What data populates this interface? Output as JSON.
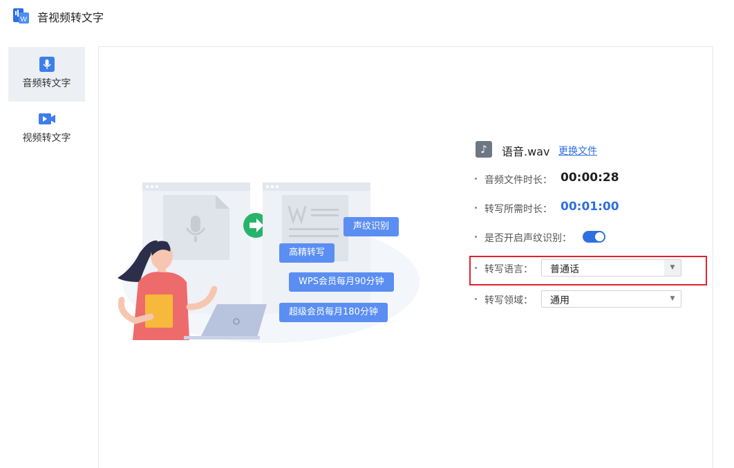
{
  "app": {
    "title": "音视频转文字",
    "logo_icon": "wps-audio-video-logo"
  },
  "sidebar": {
    "items": [
      {
        "label": "音频转文字",
        "icon": "microphone-icon",
        "active": true
      },
      {
        "label": "视频转文字",
        "icon": "video-camera-icon",
        "active": false
      }
    ]
  },
  "illustration": {
    "bubbles": {
      "voiceprint": "声纹识别",
      "hq": "高精转写",
      "wps": "WPS会员每月90分钟",
      "super": "超级会员每月180分钟"
    }
  },
  "panel": {
    "file_name": "语音.wav",
    "change_file": "更换文件",
    "duration_label": "音频文件时长：",
    "duration_value": "00:00:28",
    "needed_label": "转写所需时长：",
    "needed_value": "00:01:00",
    "voiceprint_label": "是否开启声纹识别：",
    "voiceprint_enabled": true,
    "language_label": "转写语言：",
    "language_value": "普通话",
    "domain_label": "转写领域：",
    "domain_value": "通用"
  },
  "colors": {
    "accent": "#2f6fe0",
    "bubble": "#5b8ef2",
    "highlight": "#e0222b",
    "arrow_circle": "#27b36b"
  }
}
